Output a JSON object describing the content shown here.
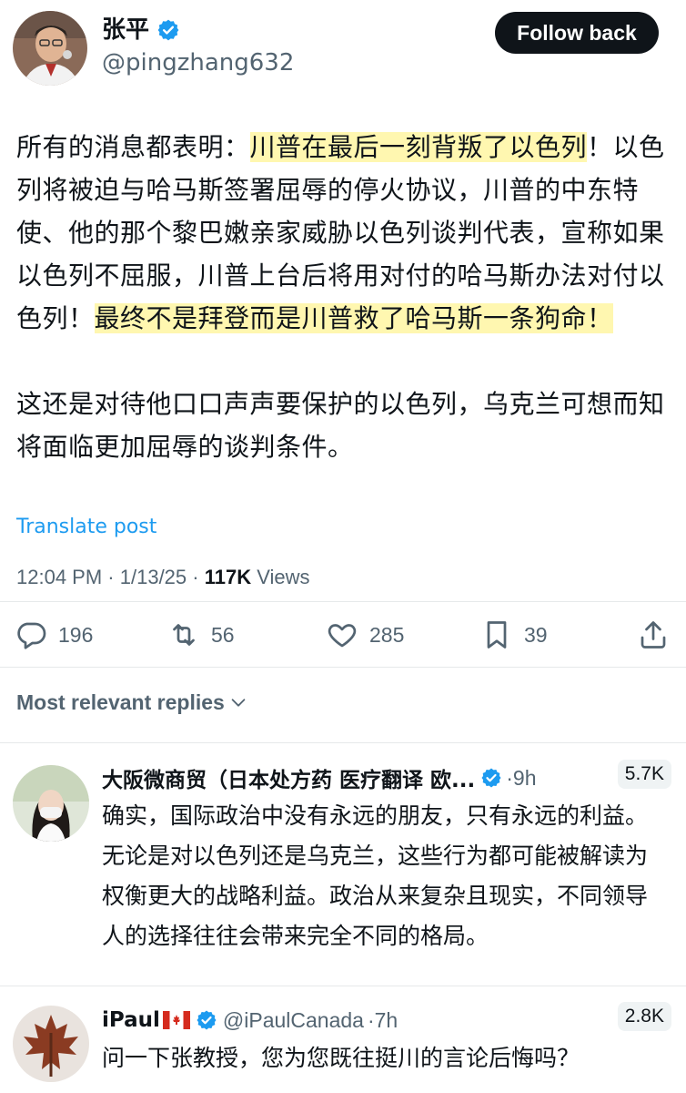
{
  "author": {
    "display_name": "张平",
    "handle": "@pingzhang632",
    "verified": true,
    "follow_label": "Follow back"
  },
  "tweet": {
    "p1_a": "所有的消息都表明：",
    "p1_hl1": "川普在最后一刻背叛了以色列",
    "p1_b": "！以色列将被迫与哈马斯签署屈辱的停火协议，川普的中东特使、他的那个黎巴嫩亲家威胁以色列谈判代表，宣称如果以色列不屈服，川普上台后将用对付的哈马斯办法对付以色列！",
    "p1_hl2": "最终不是拜登而是川普救了哈马斯一条狗命！",
    "p2": "这还是对待他口口声声要保护的以色列，乌克兰可想而知将面临更加屈辱的谈判条件。",
    "translate_label": "Translate post",
    "time": "12:04 PM",
    "date": "1/13/25",
    "views_count": "117K",
    "views_label": "Views",
    "highlight_color": "#fff7b0"
  },
  "actions": {
    "replies": "196",
    "reposts": "56",
    "likes": "285",
    "bookmarks": "39"
  },
  "replies_sort_label": "Most relevant replies",
  "replies": [
    {
      "name": "大阪微商贸（日本处方药 医疗翻译 欧...",
      "handle": "",
      "time": "9h",
      "views": "5.7K",
      "verified": true,
      "text": "确实，国际政治中没有永远的朋友，只有永远的利益。无论是对以色列还是乌克兰，这些行为都可能被解读为权衡更大的战略利益。政治从来复杂且现实，不同领导人的选择往往会带来完全不同的格局。"
    },
    {
      "name": "iPaul",
      "handle": "@iPaulCanada",
      "time": "7h",
      "views": "2.8K",
      "verified": true,
      "text": "问一下张教授，您为您既往挺川的言论后悔吗？"
    }
  ],
  "colors": {
    "accent": "#1d9bf0",
    "muted": "#536471",
    "text": "#0f1419"
  }
}
